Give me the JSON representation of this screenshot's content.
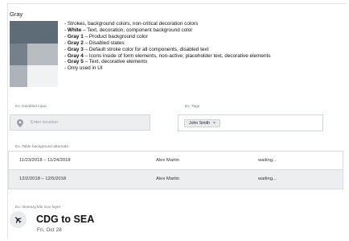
{
  "section": {
    "title": "Gray"
  },
  "colors": {
    "gray_top": "#5e6c78",
    "gray_1": "#75808a",
    "gray_2": "#b6bcc2",
    "gray_3": "#adb3b9",
    "gray_4": "#f1f2f3"
  },
  "legend": [
    {
      "bold": "",
      "text": "- Strokes, background colors, non-critical decoration colors"
    },
    {
      "bold": "White",
      "text": " – Text, decoration, component background color"
    },
    {
      "bold": "Gray 1",
      "text": " – Product background color"
    },
    {
      "bold": "Gray 2",
      "text": " – Disabled states"
    },
    {
      "bold": "Gray 3",
      "text": " – Default stroke color for all components, disabled text"
    },
    {
      "bold": "Gray 4",
      "text": " – Icons inside of form elements, non-active; placeholder text, decorative elements"
    },
    {
      "bold": "Gray 5",
      "text": " – Text, decorative elements"
    },
    {
      "bold": "",
      "text": "- Only used in UI"
    }
  ],
  "disabled_input": {
    "label": "Ex. Disabled input",
    "placeholder": "Enter location",
    "icon": "location-pin-icon"
  },
  "tags": {
    "label": "Ex. Tags",
    "chip_label": "John Smith",
    "remove_glyph": "×"
  },
  "table": {
    "label": "Ex. Table background alternate",
    "rows": [
      {
        "dates": "11/23/2018 – 11/24/2018",
        "name": "Alex Martin",
        "status": "waiting..."
      },
      {
        "dates": "12/2/2018 – 12/5/2018",
        "name": "Alex Martin",
        "status": "waiting..."
      }
    ]
  },
  "itinerary": {
    "label": "Ex. Itinerary title icon layer",
    "title": "CDG to SEA",
    "date": "Fri, Oct 28",
    "icon": "airplane-icon"
  }
}
